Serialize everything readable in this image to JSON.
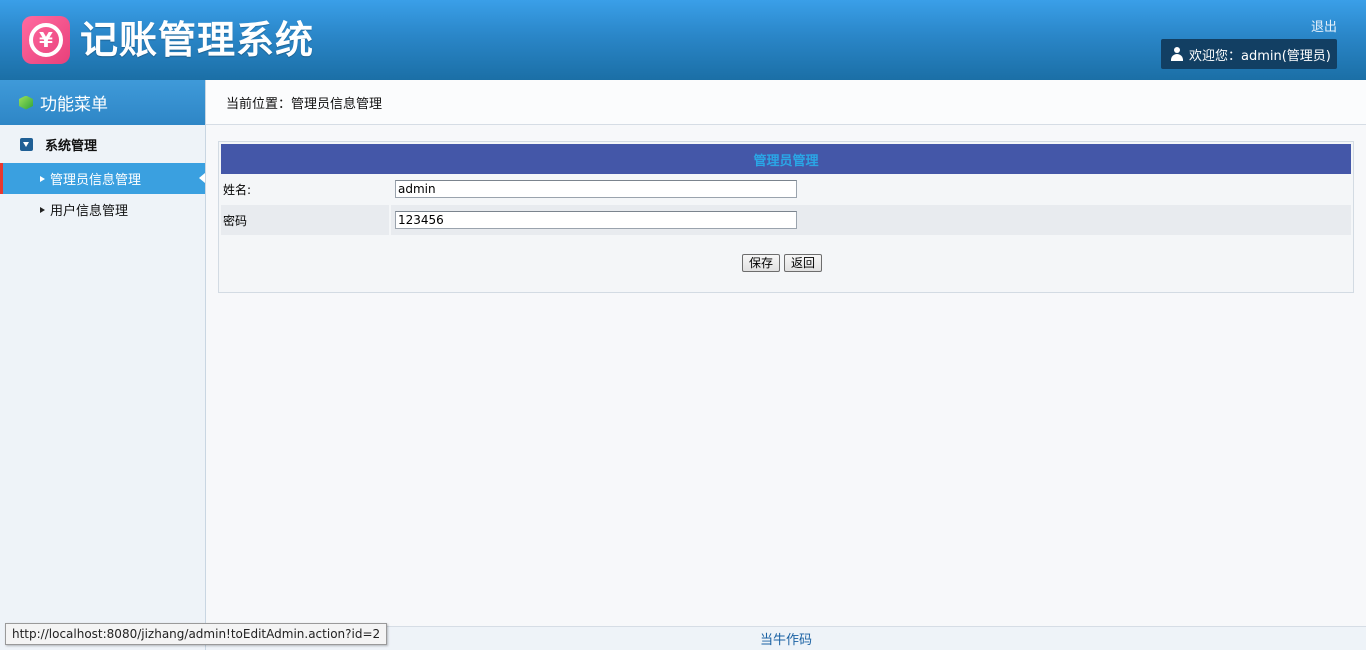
{
  "header": {
    "logo_symbol": "¥",
    "title": "记账管理系统",
    "logout_label": "退出",
    "welcome_text": "欢迎您：admin(管理员)"
  },
  "sidebar": {
    "menu_title": "功能菜单",
    "group_label": "系统管理",
    "items": [
      {
        "label": "管理员信息管理",
        "active": true
      },
      {
        "label": "用户信息管理",
        "active": false
      }
    ]
  },
  "breadcrumb": {
    "text": "当前位置：管理员信息管理"
  },
  "form": {
    "title": "管理员管理",
    "name_label": "姓名:",
    "name_value": "admin",
    "password_label": "密码",
    "password_value": "123456",
    "save_label": "保存",
    "back_label": "返回"
  },
  "footer": {
    "text": "当牛作码"
  },
  "status_bar": {
    "url": "http://localhost:8080/jizhang/admin!toEditAdmin.action?id=2"
  },
  "colors": {
    "header_blue": "#2a86c8",
    "panel_head": "#4457a8",
    "active_item": "#3aa0e0",
    "active_marker": "#e8372f"
  }
}
